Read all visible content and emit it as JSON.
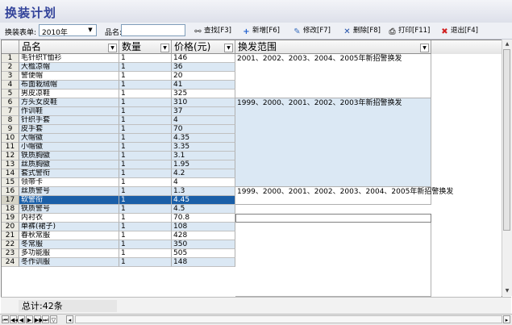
{
  "window_title": "换装计划",
  "toolbar": {
    "table_label": "换装表单:",
    "table_value": "2010年",
    "name_label": "品名:",
    "name_value": "",
    "find": "查找[F3]",
    "add": "新增[F6]",
    "edit": "修改[F7]",
    "delete": "删除[F8]",
    "print": "打印[F11]",
    "exit": "退出[F4]"
  },
  "columns": {
    "name": "品名",
    "qty": "数量",
    "price": "价格(元)",
    "range": "换发范围"
  },
  "rows": [
    {
      "n": "1",
      "name": "毛针织T恤衫",
      "qty": "1",
      "price": "146"
    },
    {
      "n": "2",
      "name": "大檐凉帽",
      "qty": "1",
      "price": "36"
    },
    {
      "n": "3",
      "name": "警便帽",
      "qty": "1",
      "price": "20"
    },
    {
      "n": "4",
      "name": "布面栽绒帽",
      "qty": "1",
      "price": "41"
    },
    {
      "n": "5",
      "name": "男皮凉鞋",
      "qty": "1",
      "price": "325"
    },
    {
      "n": "6",
      "name": "方头女皮鞋",
      "qty": "1",
      "price": "310"
    },
    {
      "n": "7",
      "name": "作训鞋",
      "qty": "1",
      "price": "37"
    },
    {
      "n": "8",
      "name": "针织手套",
      "qty": "1",
      "price": "4"
    },
    {
      "n": "9",
      "name": "皮手套",
      "qty": "1",
      "price": "70"
    },
    {
      "n": "10",
      "name": "大帽徽",
      "qty": "1",
      "price": "4.35"
    },
    {
      "n": "11",
      "name": "小帽徽",
      "qty": "1",
      "price": "3.35"
    },
    {
      "n": "12",
      "name": "铁质胸徽",
      "qty": "1",
      "price": "3.1"
    },
    {
      "n": "13",
      "name": "丝质胸徽",
      "qty": "1",
      "price": "1.95"
    },
    {
      "n": "14",
      "name": "套式警衔",
      "qty": "1",
      "price": "4.2"
    },
    {
      "n": "15",
      "name": "领带卡",
      "qty": "1",
      "price": "4"
    },
    {
      "n": "16",
      "name": "丝质警号",
      "qty": "1",
      "price": "1.3"
    },
    {
      "n": "17",
      "name": "软警衔",
      "qty": "1",
      "price": "4.45"
    },
    {
      "n": "18",
      "name": "铁质警号",
      "qty": "1",
      "price": "4.5"
    },
    {
      "n": "19",
      "name": "内衬衣",
      "qty": "1",
      "price": "70.8"
    },
    {
      "n": "20",
      "name": "单裤(裙子)",
      "qty": "1",
      "price": "108"
    },
    {
      "n": "21",
      "name": "春秋常服",
      "qty": "1",
      "price": "428"
    },
    {
      "n": "22",
      "name": "冬常服",
      "qty": "1",
      "price": "350"
    },
    {
      "n": "23",
      "name": "多功能服",
      "qty": "1",
      "price": "505"
    },
    {
      "n": "24",
      "name": "冬作训服",
      "qty": "1",
      "price": "148"
    }
  ],
  "ranges": [
    "2001、2002、2003、2004、2005年新招警换发",
    "1999、2000、2001、2002、2003年新招警换发",
    "1999、2000、2001、2002、2003、2004、2005年新招警换发"
  ],
  "total": "总计:42条",
  "colors": {
    "title": "#33439a",
    "selection": "#1a5fa8",
    "shade": "#dbe8f4"
  }
}
